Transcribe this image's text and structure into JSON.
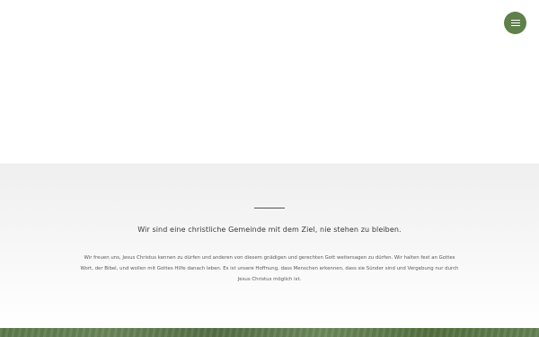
{
  "header": {
    "menu_icon": "hamburger-icon",
    "accent_color": "#5f7f4b"
  },
  "intro": {
    "headline": "Wir sind eine christliche Gemeinde mit dem Ziel, nie stehen zu bleiben.",
    "body": "Wir freuen uns, Jesus Christus kennen zu dürfen und anderen von diesem gnädigen und gerechten Gott weitersagen zu dürfen. Wir halten fest an Gottes Wort, der Bibel, und wollen mit Gottes Hilfe danach leben. Es ist unsere Hoffnung, dass Menschen erkennen, dass sie Sünder sind und Vergebung nur durch Jesus Christus möglich ist."
  },
  "footer_band": {
    "color": "#5d7a4c"
  }
}
